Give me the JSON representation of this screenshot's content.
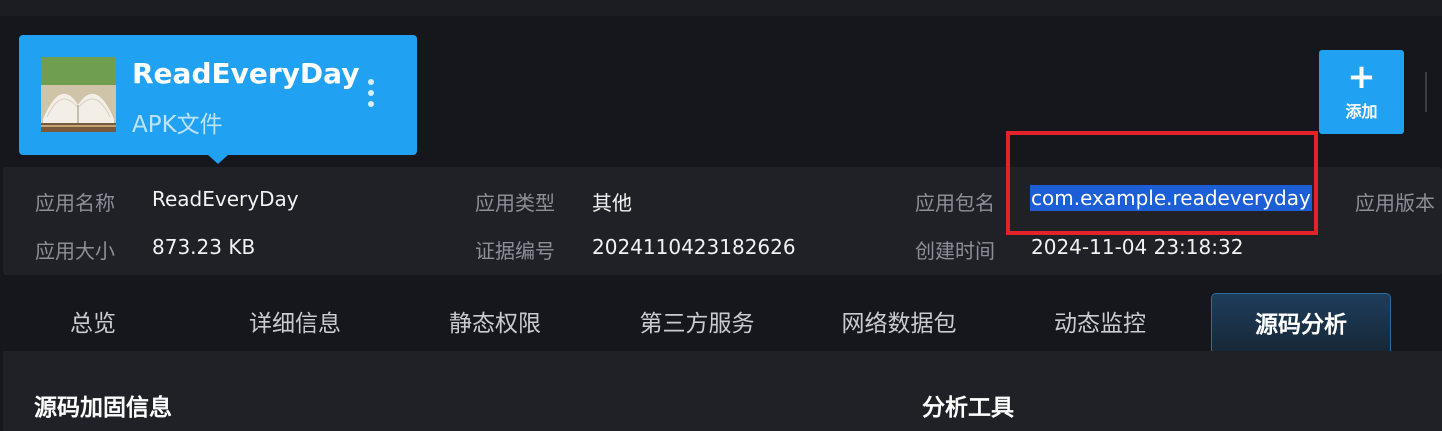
{
  "app": {
    "name": "ReadEveryDay",
    "type": "APK文件",
    "icon": "book-icon"
  },
  "toolbar": {
    "add_label": "添加",
    "add_icon": "+"
  },
  "info": {
    "app_name_label": "应用名称",
    "app_name_value": "ReadEveryDay",
    "app_type_label": "应用类型",
    "app_type_value": "其他",
    "package_label": "应用包名",
    "package_value": "com.example.readeveryday",
    "version_label": "应用版本",
    "size_label": "应用大小",
    "size_value": "873.23 KB",
    "cert_label": "证据编号",
    "cert_value": "2024110423182626",
    "created_label": "创建时间",
    "created_value": "2024-11-04 23:18:32"
  },
  "tabs": [
    {
      "label": "总览"
    },
    {
      "label": "详细信息"
    },
    {
      "label": "静态权限"
    },
    {
      "label": "第三方服务"
    },
    {
      "label": "网络数据包"
    },
    {
      "label": "动态监控"
    },
    {
      "label": "源码分析",
      "active": true
    }
  ],
  "content": {
    "left_title": "源码加固信息",
    "right_title": "分析工具"
  },
  "colors": {
    "accent": "#21a1f1",
    "highlight": "#1c5ed6",
    "annotation": "#e3232a"
  }
}
